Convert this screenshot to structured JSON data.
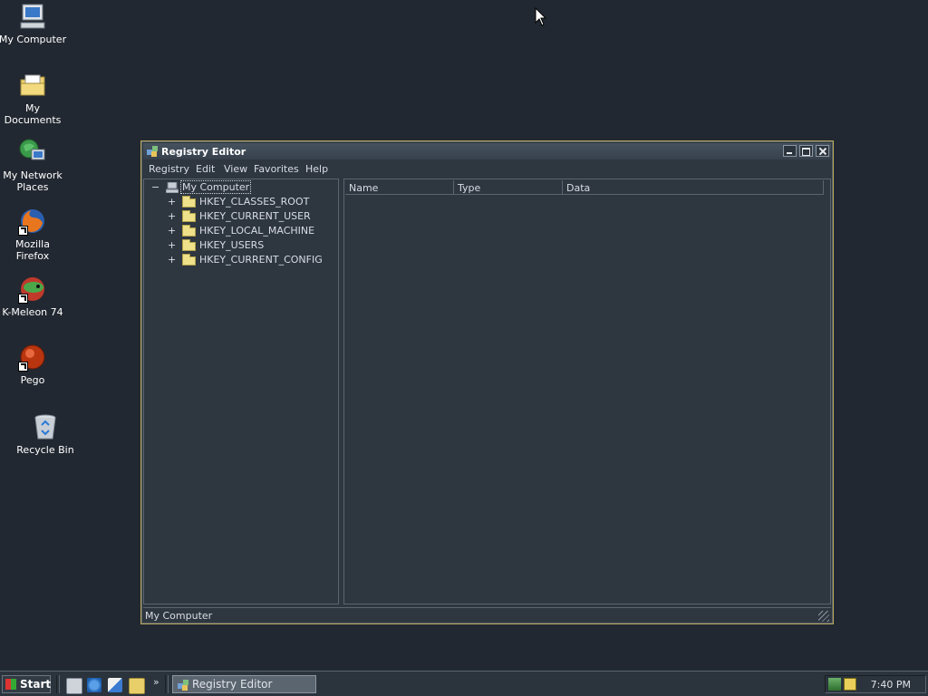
{
  "desktop": {
    "icons": [
      {
        "label": "My Computer",
        "icon": "computer-icon"
      },
      {
        "label": "My Documents",
        "icon": "folder-documents-icon"
      },
      {
        "label": "My Network Places",
        "icon": "network-places-icon"
      },
      {
        "label": "Mozilla Firefox",
        "icon": "firefox-icon"
      },
      {
        "label": "K-Meleon 74",
        "icon": "k-meleon-icon"
      },
      {
        "label": "Pego",
        "icon": "pego-icon"
      },
      {
        "label": "Recycle Bin",
        "icon": "recycle-bin-icon"
      }
    ]
  },
  "window": {
    "title": "Registry Editor",
    "menu": [
      "Registry",
      "Edit",
      "View",
      "Favorites",
      "Help"
    ],
    "tree": {
      "root": "My Computer",
      "root_expander": "−",
      "children": [
        {
          "expander": "+",
          "label": "HKEY_CLASSES_ROOT"
        },
        {
          "expander": "+",
          "label": "HKEY_CURRENT_USER"
        },
        {
          "expander": "+",
          "label": "HKEY_LOCAL_MACHINE"
        },
        {
          "expander": "+",
          "label": "HKEY_USERS"
        },
        {
          "expander": "+",
          "label": "HKEY_CURRENT_CONFIG"
        }
      ]
    },
    "list": {
      "columns": [
        "Name",
        "Type",
        "Data"
      ]
    },
    "status": "My Computer"
  },
  "taskbar": {
    "start_label": "Start",
    "more_glyph": "»",
    "task_label": "Registry Editor",
    "clock": "7:40 PM"
  },
  "colors": {
    "desktop_bg": "#222831",
    "window_border": "#b8a65a",
    "folder": "#efe08a"
  }
}
